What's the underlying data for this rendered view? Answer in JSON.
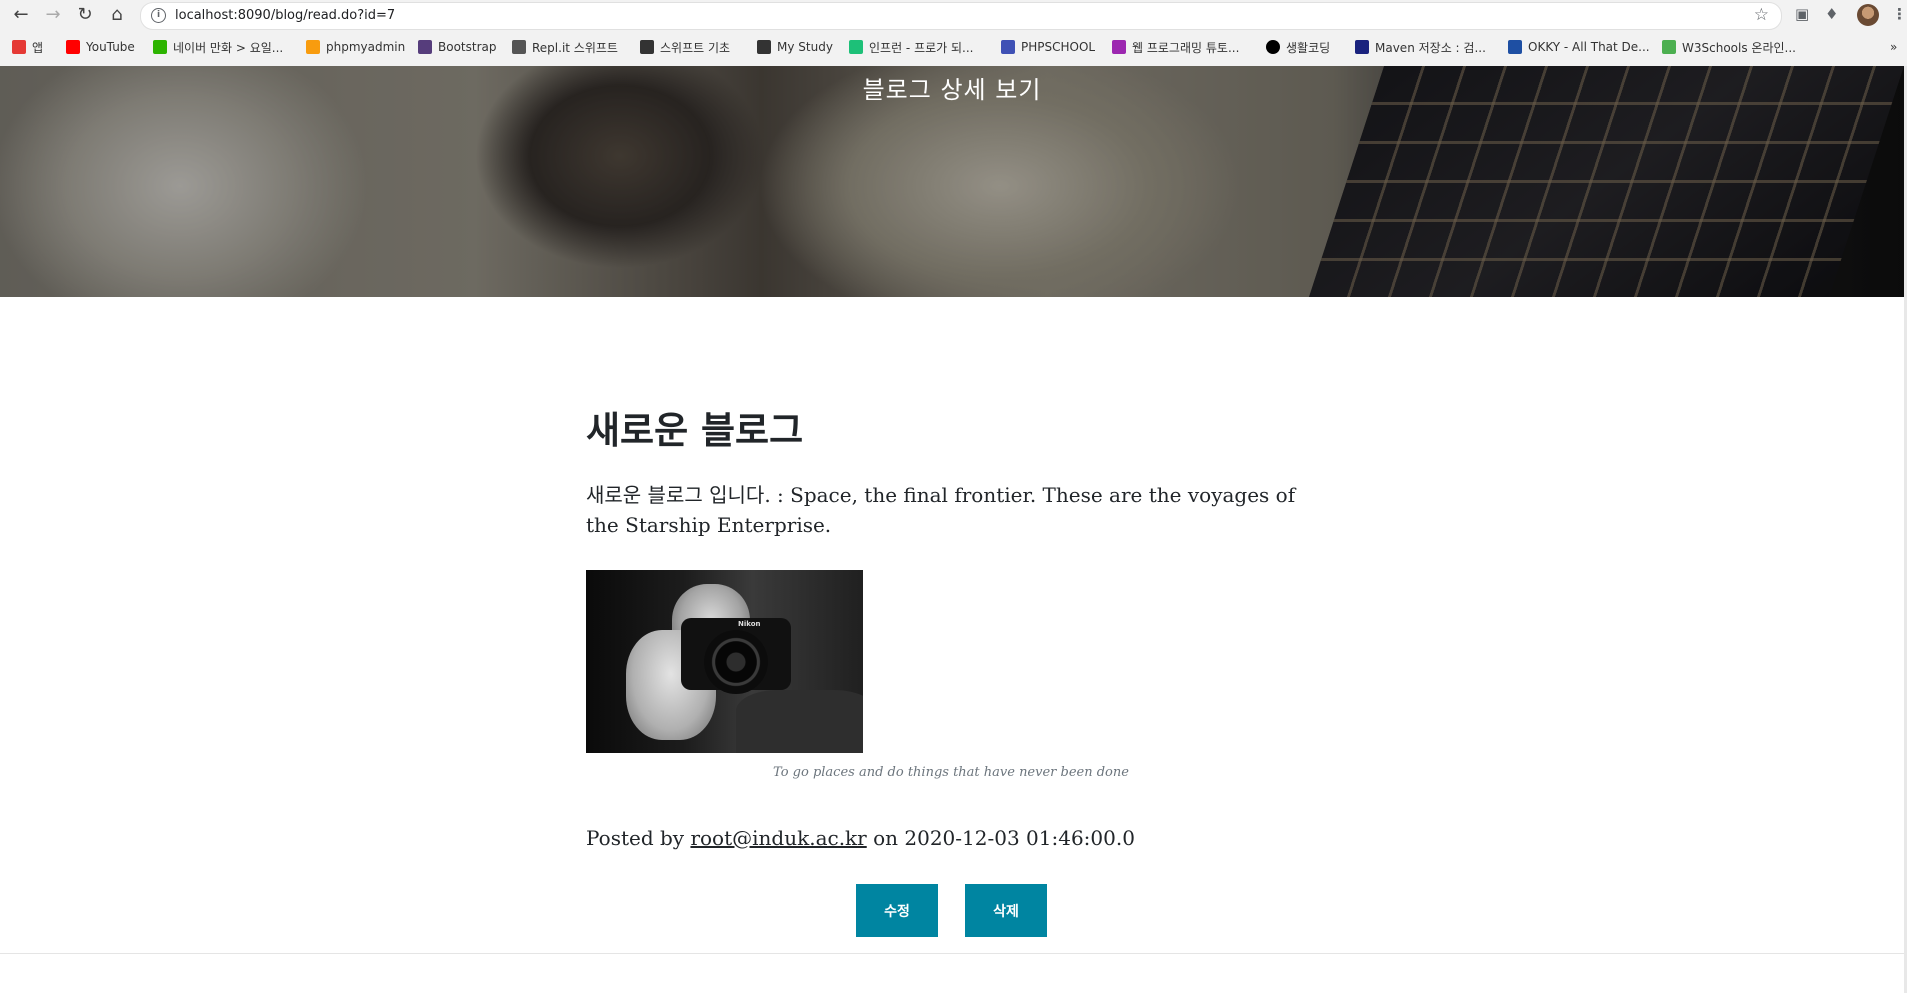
{
  "browser": {
    "url": "localhost:8090/blog/read.do?id=7",
    "bookmarks": [
      {
        "label": "앱",
        "icon": "apps-grid-icon",
        "color": "#e53935"
      },
      {
        "label": "YouTube",
        "icon": "youtube-icon",
        "color": "#ff0000"
      },
      {
        "label": "네이버 만화 > 요일...",
        "icon": "naver-webtoon-icon",
        "color": "#2db400"
      },
      {
        "label": "phpmyadmin",
        "icon": "phpmyadmin-icon",
        "color": "#f89c0e"
      },
      {
        "label": "Bootstrap",
        "icon": "bootstrap-icon",
        "color": "#563d7c"
      },
      {
        "label": "Repl.it 스위프트",
        "icon": "replit-icon",
        "color": "#555555"
      },
      {
        "label": "스위프트 기초",
        "icon": "globe-icon",
        "color": "#333333"
      },
      {
        "label": "My Study",
        "icon": "dots-icon",
        "color": "#333333"
      },
      {
        "label": "인프런 - 프로가 되...",
        "icon": "inflearn-icon",
        "color": "#1dc078"
      },
      {
        "label": "PHPSCHOOL",
        "icon": "phpschool-icon",
        "color": "#3f51b5"
      },
      {
        "label": "웹 프로그래밍 튜토...",
        "icon": "web-tutorial-icon",
        "color": "#9c27b0"
      },
      {
        "label": "생활코딩",
        "icon": "circle-icon",
        "color": "#000000"
      },
      {
        "label": "Maven 저장소 : 검...",
        "icon": "maven-icon",
        "color": "#1a237e"
      },
      {
        "label": "OKKY - All That De...",
        "icon": "okky-icon",
        "color": "#1e4fa3"
      },
      {
        "label": "W3Schools 온라인...",
        "icon": "w3schools-icon",
        "color": "#4caf50"
      }
    ]
  },
  "header": {
    "title": "블로그 상세 보기"
  },
  "post": {
    "title": "새로운 블로그",
    "body": "새로운 블로그 입니다. : Space, the final frontier. These are the voyages of the Starship Enterprise.",
    "image_caption": "To go places and do things that have never been done",
    "meta": {
      "prefix": "Posted by ",
      "author": "root@induk.ac.kr",
      "on": " on ",
      "date": "2020-12-03 01:46:00.0"
    },
    "actions": {
      "edit": "수정",
      "delete": "삭제"
    }
  },
  "colors": {
    "button": "#0085a1",
    "text": "#212529",
    "caption": "#6c757d"
  }
}
